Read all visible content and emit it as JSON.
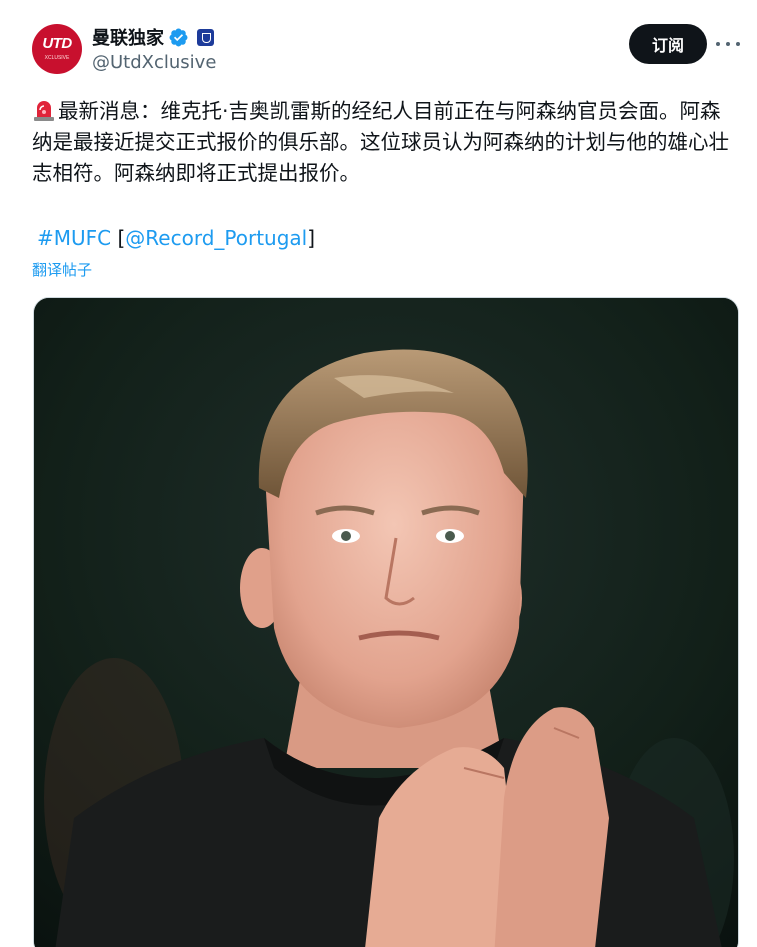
{
  "account": {
    "display_name": "曼联独家",
    "handle": "@UtdXclusive",
    "avatar_text": "UTD",
    "avatar_subtext": "XCLUSIVE"
  },
  "actions": {
    "subscribe_label": "订阅"
  },
  "tweet": {
    "body": "最新消息：维克托·吉奥凯雷斯的经纪人目前正在与阿森纳官员会面。阿森纳是最接近提交正式报价的俱乐部。这位球员认为阿森纳的计划与他的雄心壮志相符。阿森纳即将正式提出报价。",
    "hashtag": "#MUFC",
    "bracket_open": "[",
    "mention": "@Record_Portugal",
    "bracket_close": "]",
    "translate_label": "翻译帖子"
  },
  "colors": {
    "accent": "#1d9bf0",
    "button_bg": "#0f1419",
    "secondary_text": "#536471",
    "avatar_red": "#c8102e"
  },
  "icons": [
    "siren-emoji-icon",
    "verified-badge-icon",
    "affiliate-badge-icon",
    "more-options-icon"
  ]
}
